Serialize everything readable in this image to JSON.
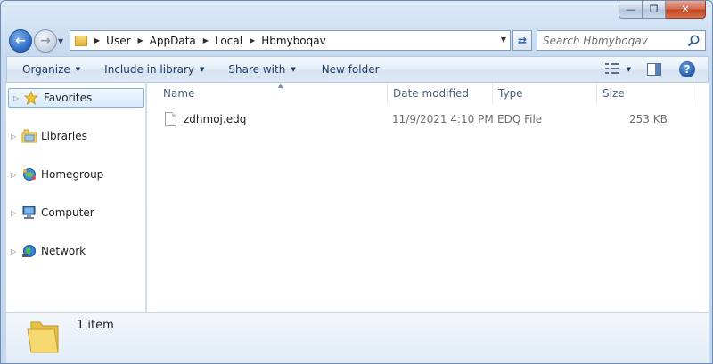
{
  "window": {
    "caption": {
      "minimize": "—",
      "maximize": "❐",
      "close": "✕"
    }
  },
  "address_bar": {
    "breadcrumbs": [
      "User",
      "AppData",
      "Local",
      "Hbmyboqav"
    ],
    "search_placeholder": "Search Hbmyboqav"
  },
  "toolbar": {
    "organize": "Organize",
    "include_in_library": "Include in library",
    "share_with": "Share with",
    "new_folder": "New folder",
    "help": "?"
  },
  "nav_pane": {
    "items": [
      {
        "label": "Favorites",
        "icon": "star-icon"
      },
      {
        "label": "Libraries",
        "icon": "libraries-icon"
      },
      {
        "label": "Homegroup",
        "icon": "homegroup-icon"
      },
      {
        "label": "Computer",
        "icon": "computer-icon"
      },
      {
        "label": "Network",
        "icon": "network-icon"
      }
    ]
  },
  "file_list": {
    "columns": [
      "Name",
      "Date modified",
      "Type",
      "Size"
    ],
    "rows": [
      {
        "name": "zdhmoj.edq",
        "date": "11/9/2021 4:10 PM",
        "type": "EDQ File",
        "size": "253 KB"
      }
    ]
  },
  "details": {
    "item_count": "1 item"
  },
  "colors": {
    "window_frame": "#c7daf0",
    "selection_border": "#84acdd",
    "close_button": "#c1441f",
    "folder_yellow": "#e2b43c"
  }
}
